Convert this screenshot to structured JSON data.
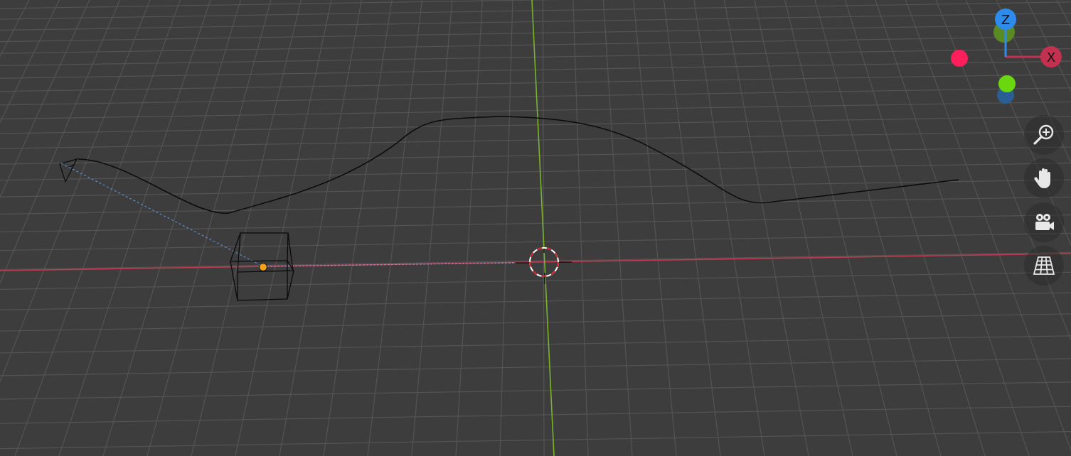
{
  "app": {
    "view": "3D Viewport"
  },
  "colors": {
    "background": "#3d3d3d",
    "grid": "#545454",
    "axis_x": "#c23a52",
    "axis_y": "#7ab32b",
    "axis_z": "#2d8ceb",
    "curve": "#0a0a0a",
    "selection_dot": "#f5a21b"
  },
  "gizmo": {
    "x_label": "X",
    "z_label": "Z",
    "x_color": "#c2314f",
    "neg_x_color": "#ff1f5a",
    "y_color": "#6bd80f",
    "neg_y_color": "#5a8a24",
    "z_color": "#2d8ceb",
    "neg_z_color": "#2a5f95"
  },
  "nav_buttons": [
    {
      "name": "zoom-button",
      "icon": "zoom-in-icon"
    },
    {
      "name": "pan-button",
      "icon": "hand-icon"
    },
    {
      "name": "camera-view-button",
      "icon": "camera-icon"
    },
    {
      "name": "perspective-toggle-button",
      "icon": "grid-perspective-icon"
    }
  ]
}
